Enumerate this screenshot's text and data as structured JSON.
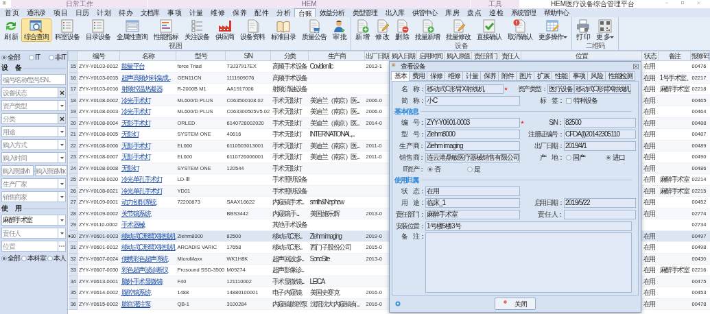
{
  "window": {
    "title": "HEM医疗设备综合管理平台"
  },
  "context_groups": [
    {
      "label": "日常工作"
    },
    {
      "label": "HEM"
    },
    {
      "label": "工具"
    }
  ],
  "menu_tabs": [
    {
      "label": "首 页",
      "selected": false
    },
    {
      "label": "通讯录",
      "selected": false
    },
    {
      "label": "项 目",
      "selected": false
    },
    {
      "label": "日 历",
      "selected": false
    },
    {
      "label": "计 划",
      "selected": false
    },
    {
      "label": "待 办",
      "selected": false
    },
    {
      "label": "文档库",
      "selected": false
    },
    {
      "label": "事 项",
      "selected": false
    },
    {
      "label": "计 量",
      "selected": false
    },
    {
      "label": "维 修",
      "selected": false
    },
    {
      "label": "保 养",
      "selected": false
    },
    {
      "label": "配 件",
      "selected": false
    },
    {
      "label": "分 析",
      "selected": false
    },
    {
      "label": "台 账",
      "selected": true
    },
    {
      "label": "效益分析",
      "selected": false
    },
    {
      "label": "类型管理",
      "selected": false
    },
    {
      "label": "出入库",
      "selected": false
    },
    {
      "label": "供管中心",
      "selected": false
    },
    {
      "label": "库 房",
      "selected": false
    },
    {
      "label": "盘 点",
      "selected": false
    },
    {
      "label": "巡 检",
      "selected": false
    },
    {
      "label": "系统管理",
      "selected": false
    },
    {
      "label": "帮助中心",
      "selected": false
    }
  ],
  "ribbon": [
    {
      "label": "视 图",
      "buttons": [
        {
          "label": "刷 新",
          "kind": "refresh",
          "selected": false
        },
        {
          "label": "综合查询",
          "kind": "search",
          "selected": true
        },
        {
          "label": "科室设备",
          "kind": "list",
          "selected": false
        },
        {
          "label": "目录设备",
          "kind": "list",
          "selected": false
        },
        {
          "label": "全属性查询",
          "kind": "form",
          "selected": false
        },
        {
          "label": "性能指标",
          "kind": "bars",
          "selected": false
        },
        {
          "label": "关注设备",
          "kind": "checklist",
          "selected": false
        },
        {
          "label": "供应商",
          "kind": "factory",
          "selected": false
        },
        {
          "label": "设备资料",
          "kind": "document",
          "selected": false
        },
        {
          "label": "标准目录",
          "kind": "book",
          "selected": false
        },
        {
          "label": "质量公告",
          "kind": "cart",
          "selected": false
        },
        {
          "label": "审 批",
          "kind": "person",
          "selected": false
        }
      ]
    },
    {
      "label": "设 备",
      "buttons": [
        {
          "label": "新 增",
          "kind": "add",
          "selected": false
        },
        {
          "label": "修 改",
          "kind": "edit",
          "selected": false
        },
        {
          "label": "删 除",
          "kind": "delete",
          "selected": false
        },
        {
          "label": "批量新增",
          "kind": "add",
          "selected": false
        },
        {
          "label": "批量修改",
          "kind": "edit",
          "selected": false
        },
        {
          "label": "直接确认",
          "kind": "confirm",
          "selected": false
        },
        {
          "label": "取消确认",
          "kind": "cancel",
          "selected": false
        },
        {
          "label": "更多操作",
          "kind": "grid",
          "selected": false,
          "dropdown": true
        }
      ]
    },
    {
      "label": "二维码",
      "buttons": [
        {
          "label": "打 印",
          "kind": "print",
          "selected": false
        },
        {
          "label": "更 多",
          "kind": "qrcode",
          "selected": false,
          "dropdown": true
        }
      ]
    }
  ],
  "filter_panel": {
    "scope_radios": [
      {
        "label": "全部",
        "selected": true
      },
      {
        "label": "IT",
        "selected": false
      },
      {
        "label": "非IT",
        "selected": false
      }
    ],
    "sections": [
      {
        "title": "设　备",
        "fields": [
          {
            "kind": "text",
            "placeholder": "编号/名称/型号/SN..."
          },
          {
            "kind": "clear",
            "placeholder": "设备状态"
          },
          {
            "kind": "dropdown",
            "placeholder": "资产类型"
          },
          {
            "kind": "clear",
            "placeholder": "分类"
          },
          {
            "kind": "dropdown",
            "placeholder": "用途"
          },
          {
            "kind": "dropdown",
            "placeholder": "购入方式"
          },
          {
            "kind": "dropdown",
            "placeholder": "购入时间"
          },
          {
            "kind": "range",
            "min_placeholder": "购入原值Min",
            "separator": "-",
            "max_placeholder": "购入原值Max"
          },
          {
            "kind": "dropdown",
            "placeholder": "生产厂家"
          },
          {
            "kind": "dropdown",
            "placeholder": "销售商家"
          }
        ]
      },
      {
        "title": "使　用",
        "fields": [
          {
            "kind": "dropdown",
            "value": "麻醉手术室"
          },
          {
            "kind": "dropdown",
            "placeholder": "责任人"
          },
          {
            "kind": "ellipsis",
            "placeholder": "位置"
          }
        ]
      }
    ],
    "owner_radios": [
      {
        "label": "全部",
        "selected": true
      },
      {
        "label": "本科室",
        "selected": false
      },
      {
        "label": "本人",
        "selected": false
      }
    ]
  },
  "table": {
    "columns": [
      "编号",
      "名称",
      "型号",
      "S/N",
      "分类",
      "生产商",
      "出厂日期",
      "购入日期",
      "启用时间",
      "购入原值",
      "责任部门",
      "责任人",
      "位置",
      "状态",
      "备注",
      "报修码"
    ],
    "rows": [
      {
        "index": "15",
        "code": "ZYY-Y0103-0012",
        "name": "能量平台",
        "model": "force Triad",
        "sn": "T3J37917EX",
        "category": "高频手术设备",
        "maker": "Covidien llc",
        "made": "2013-1",
        "status": "在用",
        "repair_code": "00476",
        "selected": false
      },
      {
        "index": "16",
        "code": "ZYY-Y0103-0015",
        "name": "超声高频外科集成...",
        "model": "GEN11CN",
        "sn": "1111909076",
        "category": "高频手术设备",
        "status": "在用",
        "note": "1号手术室。",
        "repair_code": "02217",
        "selected": false
      },
      {
        "index": "17",
        "code": "ZYY-Y0103-0016",
        "name": "射频控温热凝器",
        "model": "R-2000B M1",
        "sn": "AA1917006",
        "category": "射频消融设备",
        "status": "在用",
        "note": "麻醉手术室",
        "repair_code": "02218",
        "selected": false
      },
      {
        "index": "18",
        "code": "ZYY-Y0108-0002",
        "name": "冷光手术灯",
        "model": "ML600/D PLUS",
        "sn": "C063500108.02",
        "category": "手术无影灯",
        "maker": "美迪兰（南京）医...",
        "made": "2006-0",
        "status": "在用",
        "repair_code": "00465",
        "selected": false
      },
      {
        "index": "19",
        "code": "ZYY-Y0108-0003",
        "name": "冷光手术灯",
        "model": "ML600/D PLUS",
        "sn": "C063300505V5.02",
        "category": "手术无影灯",
        "maker": "美迪兰（南京）医...",
        "made": "2006-0",
        "status": "在用",
        "repair_code": "00464",
        "selected": false
      },
      {
        "index": "20",
        "code": "ZYY-Y0108-0004",
        "name": "无影手术灯",
        "model": "ORLED",
        "sn": "6140728002020",
        "category": "手术无影灯",
        "maker": "美迪兰（南京）医...",
        "made": "2014-0",
        "status": "在用",
        "repair_code": "00488",
        "selected": false
      },
      {
        "index": "21",
        "code": "ZYY-Y0108-0005",
        "name": "无影灯",
        "model": "SYSTEM ONE",
        "sn": "40616",
        "category": "手术无影灯",
        "maker": "INTERNATIONAL,...",
        "status": "在用",
        "repair_code": "00487",
        "selected": false
      },
      {
        "index": "22",
        "code": "ZYY-Y0108-0006",
        "name": "无影手术灯",
        "model": "EL660",
        "sn": "6110503013001",
        "category": "手术无影灯",
        "maker": "美迪兰（南京）医...",
        "made": "2011-0",
        "status": "在用",
        "repair_code": "00489",
        "selected": false
      },
      {
        "index": "23",
        "code": "ZYY-Y0108-0007",
        "name": "无影手术灯",
        "model": "EL600",
        "sn": "6110726006001",
        "category": "手术无影灯",
        "maker": "美迪兰（南京）医...",
        "made": "2011-0",
        "status": "在用",
        "repair_code": "00490",
        "selected": false
      },
      {
        "index": "24",
        "code": "ZYY-Y0108-0008",
        "name": "无影灯",
        "model": "SYSTEM ONE",
        "sn": "120544",
        "category": "手术无影灯",
        "status": "在用",
        "repair_code": "00486",
        "selected": false
      },
      {
        "index": "25",
        "code": "ZYY-Y0108-0020",
        "name": "冷光单孔手术灯",
        "model": "LD-Ⅲ",
        "category": "手术照明设备",
        "status": "在用",
        "note": "麻醉手术室",
        "repair_code": "02214",
        "selected": false
      },
      {
        "index": "26",
        "code": "ZYY-Y0108-0021",
        "name": "冷光单孔手术灯",
        "model": "YD01",
        "category": "手术照明设备",
        "status": "在用",
        "note": "麻醉手术室",
        "repair_code": "02215",
        "selected": false
      },
      {
        "index": "27",
        "code": "ZYY-Y0109-0001",
        "name": "动力刨削系统",
        "model": "72200873",
        "sn": "SAAX16622",
        "category": "内窥镜手术...",
        "maker": "smith&Nephew",
        "status": "在用",
        "repair_code": "00452",
        "selected": false
      },
      {
        "index": "28",
        "code": "ZYY-Y0109-0002",
        "name": "关节镜系统",
        "sn": "BBS3442",
        "category": "内窥镜 手...",
        "maker": "美国施乐辉",
        "made": "2013-0",
        "status": "在用",
        "repair_code": "02774",
        "selected": false
      },
      {
        "index": "29",
        "code": "ZYY-Y0110-0002",
        "name": "手术器械",
        "category": "其他手术设备",
        "repair_code": "02734",
        "selected": false
      },
      {
        "index": "30",
        "code": "ZYY-Y0601-0003",
        "name": "移动式C形臂X射线机",
        "model": "Ziehm8000",
        "sn": "82500",
        "category": "移动式C形...",
        "maker": "Ziehm imaging",
        "made": "2019-0",
        "status": "在用",
        "repair_code": "00497",
        "selected": true
      },
      {
        "index": "31",
        "code": "ZYY-Y0601-0012",
        "name": "移动式C形臂X射线机",
        "model": "ARCADIS VARIC",
        "sn": "17658",
        "category": "移动式C形...",
        "maker": "西门子股份公司",
        "made": "2015-0",
        "status": "在用",
        "repair_code": "00498",
        "selected": false
      },
      {
        "index": "32",
        "code": "ZYY-Y0607-0024",
        "name": "便携彩色超声系统",
        "model": "MicroMaxx",
        "sn": "WK1H8K",
        "category": "超声回波多...",
        "maker": "SonoSite",
        "made": "2013-0",
        "status": "在用",
        "repair_code": "00430",
        "selected": false
      },
      {
        "index": "33",
        "code": "ZYY-Y0607-0030",
        "name": "彩色超声波诊断仪",
        "model": "Prosound SSD-3500",
        "sn": "M09274",
        "category": "超声影像诊...",
        "status": "在用",
        "note": "麻醉手术室",
        "repair_code": "02216",
        "selected": false
      },
      {
        "index": "34",
        "code": "ZYY-Y0613-0001",
        "name": "脑外手术显微镜",
        "model": "F40",
        "sn": "121110002",
        "category": "手术显微镜...",
        "maker": "LEICA",
        "status": "在用",
        "repair_code": "00475",
        "selected": false
      },
      {
        "index": "35",
        "code": "ZYY-Y0614-0002",
        "name": "腹腔镜系统",
        "model": "1488",
        "sn": "14880100001",
        "category": "电子内窥镜",
        "maker": "美国史赛克",
        "made": "2016-0",
        "status": "在用",
        "repair_code": "00453",
        "selected": false
      },
      {
        "index": "36",
        "code": "ZYY-Y0615-0002",
        "name": "膨宫灌注泵",
        "model": "QB-1",
        "sn": "3100284",
        "category": "内窥镜膨腔泵",
        "maker": "沈阳沈大内窥镜有...",
        "made": "2016-0",
        "status": "在用",
        "repair_code": "00478",
        "selected": false
      }
    ]
  },
  "dialog": {
    "title": "查看设备",
    "tabs": [
      {
        "label": "基本",
        "selected": true
      },
      {
        "label": "费用",
        "selected": false
      },
      {
        "label": "保修",
        "selected": false
      },
      {
        "label": "维修",
        "selected": false
      },
      {
        "label": "计量",
        "selected": false
      },
      {
        "label": "保养",
        "selected": false
      },
      {
        "label": "附件",
        "selected": false
      },
      {
        "label": "图片",
        "selected": false
      },
      {
        "label": "扩展",
        "selected": false
      },
      {
        "label": "性能",
        "selected": false
      },
      {
        "label": "事项",
        "selected": false
      },
      {
        "label": "风险",
        "selected": false
      },
      {
        "label": "性能检测",
        "selected": false
      }
    ],
    "sections": [
      {
        "rows": [
          [
            {
              "kind": "text",
              "label": "名　称：",
              "value": "移动式C形臂X射线机",
              "required": true
            },
            {
              "kind": "pair",
              "label": "资产类型：",
              "values": [
                "医疗设备",
                "移动式C形臂X射线机"
              ]
            }
          ],
          [
            {
              "kind": "text",
              "label": "简　称：",
              "value": "小C"
            },
            {
              "kind": "checkbox",
              "label": "标　签：",
              "option": "特种设备",
              "checked": false
            }
          ]
        ]
      },
      {
        "title": "基本信息",
        "rows": [
          [
            {
              "kind": "text",
              "label": "编　号：",
              "value": "ZYY-Y0601-0003",
              "required": true
            },
            {
              "kind": "text",
              "label": "S/N：",
              "value": "82500"
            }
          ],
          [
            {
              "kind": "text",
              "label": "型　号：",
              "value": "Ziehm8000"
            },
            {
              "kind": "text",
              "label": "注册证编号：",
              "value": "CFDA(I)20142305110"
            }
          ],
          [
            {
              "kind": "text",
              "label": "生 产 商：",
              "value": "Ziehm imaging"
            },
            {
              "kind": "text",
              "label": "出厂日期：",
              "value": "2019/4/1"
            }
          ],
          [
            {
              "kind": "text",
              "label": "销 售 商：",
              "value": "连云港鼎敏医疗器械销售有限公司"
            },
            {
              "kind": "radio",
              "label": "产　地：",
              "options": [
                {
                  "label": "国产",
                  "selected": false
                },
                {
                  "label": "进口",
                  "selected": true
                }
              ]
            }
          ],
          [
            {
              "kind": "radio",
              "label": "IT资产：",
              "options": [
                {
                  "label": "否",
                  "selected": true
                },
                {
                  "label": "是",
                  "selected": false
                }
              ]
            }
          ]
        ]
      },
      {
        "title": "使用归属",
        "rows": [
          [
            {
              "kind": "text",
              "label": "状　态：",
              "value": "在用"
            }
          ],
          [
            {
              "kind": "text",
              "label": "用　途：",
              "value": "临床_1"
            },
            {
              "kind": "text",
              "label": "启用日期：",
              "value": "2019/5/22"
            }
          ],
          [
            {
              "kind": "text",
              "label": "责任部门：",
              "value": "麻醉手术室"
            },
            {
              "kind": "text",
              "label": "责 任 人："
            }
          ],
          [
            {
              "kind": "wide",
              "label": "安装位置：",
              "value": "1号楼5楼3号"
            }
          ],
          [
            {
              "kind": "textarea",
              "label": "备　注："
            }
          ]
        ]
      }
    ],
    "close_button": "关闭"
  }
}
